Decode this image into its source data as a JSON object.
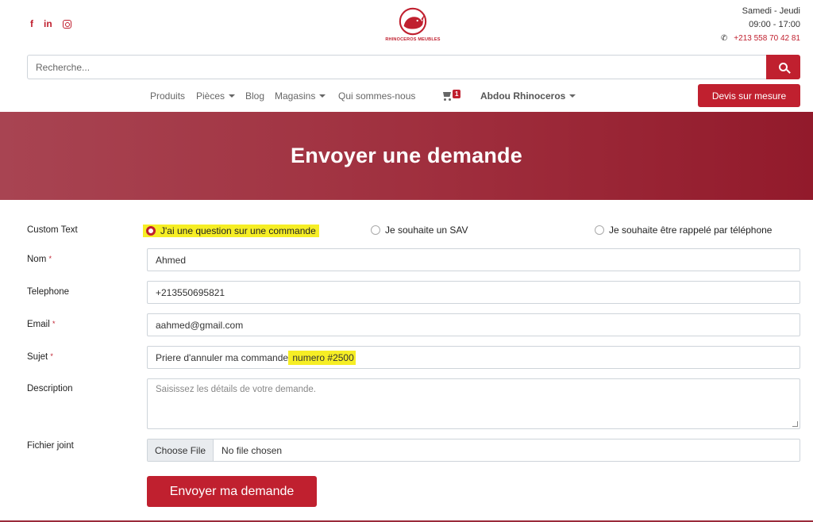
{
  "header": {
    "social": [
      {
        "icon": "facebook-icon",
        "glyph": "f"
      },
      {
        "icon": "linkedin-icon",
        "glyph": "in"
      },
      {
        "icon": "instagram-icon",
        "glyph": ""
      }
    ],
    "logo_text": "RHINOCEROS MEUBLES",
    "hours_days": "Samedi - Jeudi",
    "hours_time": "09:00 - 17:00",
    "phone": "+213 558 70 42 81"
  },
  "search": {
    "placeholder": "Recherche..."
  },
  "nav": {
    "items": [
      "Produits",
      "Pièces",
      "Blog",
      "Magasins",
      "Qui sommes-nous"
    ],
    "cart_count": "1",
    "user": "Abdou Rhinoceros",
    "cta": "Devis sur mesure"
  },
  "banner": {
    "title": "Envoyer une demande"
  },
  "form": {
    "custom_text_label": "Custom Text",
    "radio_options": [
      "J'ai une question sur une commande",
      "Je souhaite un SAV",
      "Je souhaite être rappelé par téléphone"
    ],
    "selected_option": 0,
    "nom_label": "Nom",
    "nom_value": "Ahmed",
    "telephone_label": "Telephone",
    "telephone_value": "+213550695821",
    "email_label": "Email",
    "email_value": "aahmed@gmail.com",
    "sujet_label": "Sujet",
    "sujet_value_a": "Priere d'annuler ma commande",
    "sujet_value_b": " numero #2500",
    "description_label": "Description",
    "description_placeholder": "Saisissez les détails de votre demande.",
    "file_label": "Fichier joint",
    "file_button": "Choose File",
    "file_status": "No file chosen",
    "required_mark": "*",
    "submit": "Envoyer ma demande"
  },
  "colors": {
    "brand": "#c0202f",
    "highlight": "#f6ee25"
  }
}
